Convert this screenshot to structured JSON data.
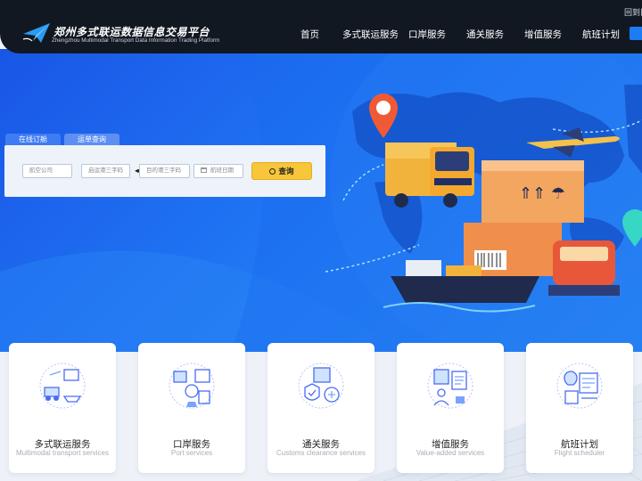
{
  "header": {
    "logo_cn": "郑州多式联运数据信息交易平台",
    "logo_en": "Zhengzhou Multimodal Transport Data Information Trading Platform",
    "top_link": "回到旧版",
    "nav": [
      {
        "label": "首页"
      },
      {
        "label": "多式联运服务"
      },
      {
        "label": "口岸服务"
      },
      {
        "label": "通关服务"
      },
      {
        "label": "增值服务"
      },
      {
        "label": "航班计划"
      }
    ]
  },
  "search": {
    "tabs": [
      {
        "label": "在线订舱"
      },
      {
        "label": "运单查询"
      }
    ],
    "airline_placeholder": "航空公司",
    "origin_placeholder": "启运港三字码",
    "swap_symbol": "◂▸",
    "dest_placeholder": "目的港三字码",
    "date_placeholder": "航班日期",
    "button_label": "查询"
  },
  "services": [
    {
      "title": "多式联运服务",
      "subtitle": "Multimodal transport services"
    },
    {
      "title": "口岸服务",
      "subtitle": "Port services"
    },
    {
      "title": "通关服务",
      "subtitle": "Customs clearance services"
    },
    {
      "title": "增值服务",
      "subtitle": "Value-added services"
    },
    {
      "title": "航班计划",
      "subtitle": "Flight scheduler"
    }
  ],
  "colors": {
    "header_bg": "#111821",
    "hero_blue": "#1f74f3",
    "search_button": "#f7c63a",
    "accent": "#1b7cf3"
  }
}
